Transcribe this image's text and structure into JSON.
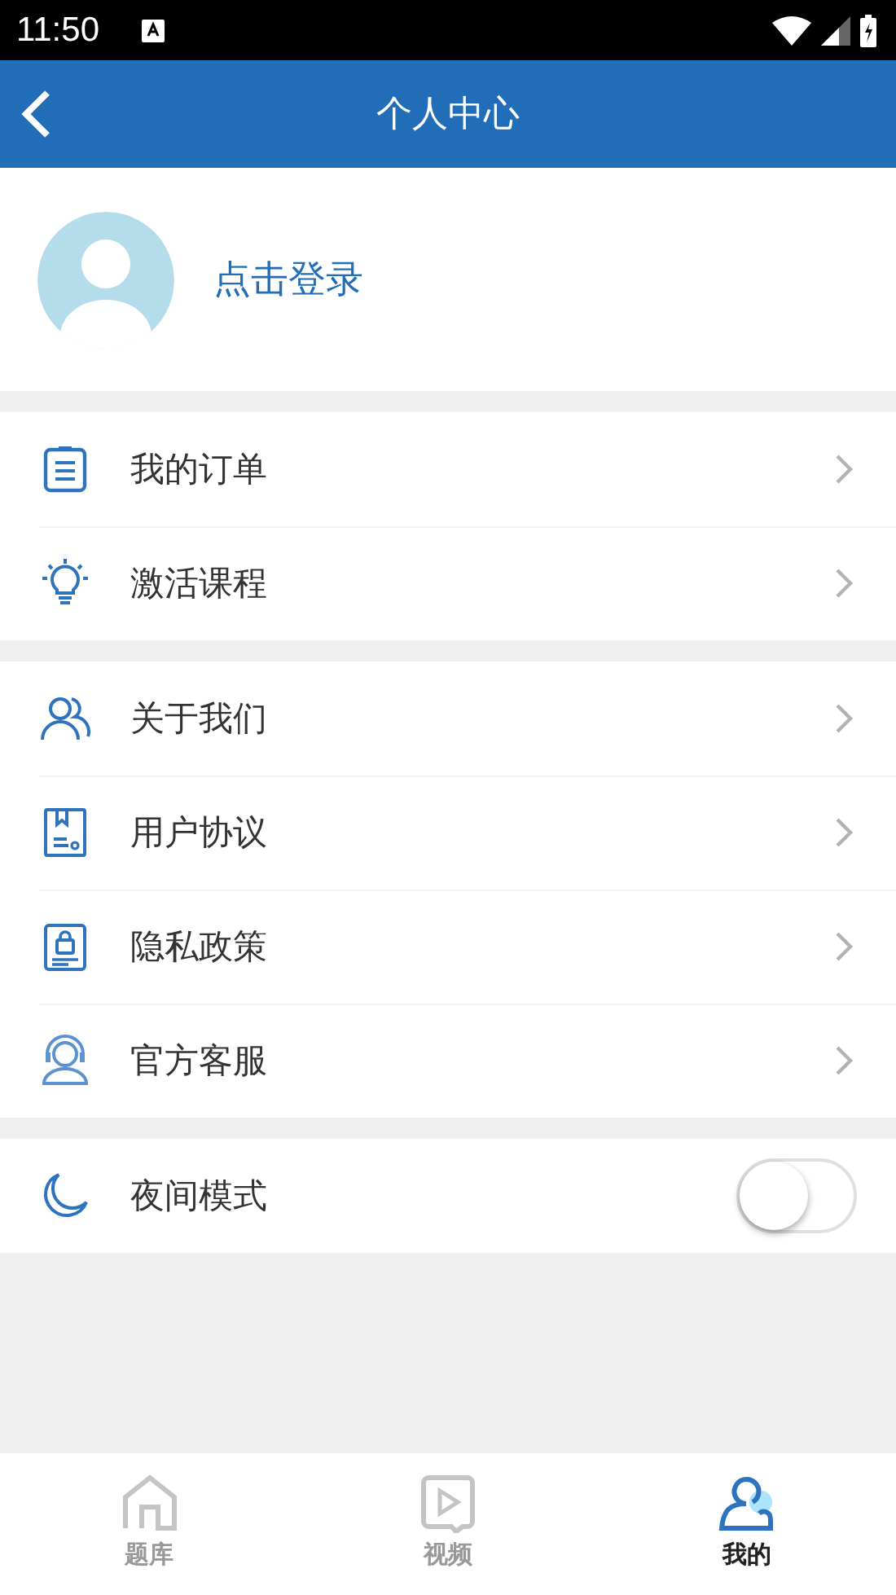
{
  "status_bar": {
    "time": "11:50"
  },
  "header": {
    "title": "个人中心"
  },
  "profile": {
    "login_label": "点击登录"
  },
  "menu_groups": [
    [
      {
        "label": "我的订单"
      },
      {
        "label": "激活课程"
      }
    ],
    [
      {
        "label": "关于我们"
      },
      {
        "label": "用户协议"
      },
      {
        "label": "隐私政策"
      },
      {
        "label": "官方客服"
      }
    ]
  ],
  "night_mode": {
    "label": "夜间模式",
    "on": false
  },
  "tabs": [
    {
      "label": "题库",
      "selected": false
    },
    {
      "label": "视频",
      "selected": false
    },
    {
      "label": "我的",
      "selected": true
    }
  ]
}
